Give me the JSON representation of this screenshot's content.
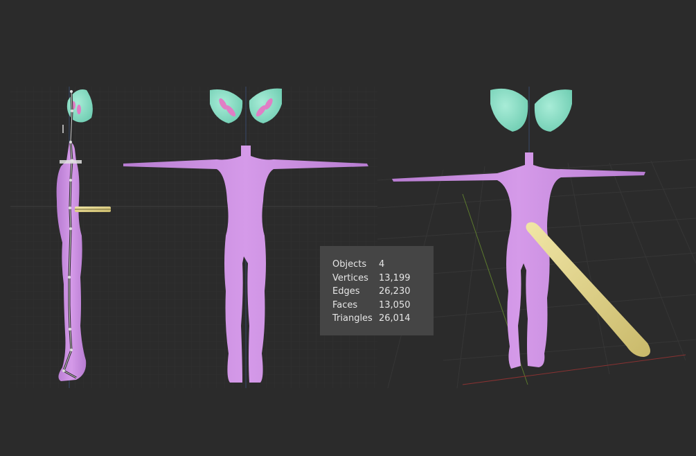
{
  "colors": {
    "background": "#2b2b2b",
    "body": "#cc8fe4",
    "ears": "#8fe0c8",
    "tail": "#e6d88d",
    "bone": "#d9d9d9",
    "stats_bg": "#454545"
  },
  "stats": {
    "rows": [
      {
        "label": "Objects",
        "value": "4"
      },
      {
        "label": "Vertices",
        "value": "13,199"
      },
      {
        "label": "Edges",
        "value": "26,230"
      },
      {
        "label": "Faces",
        "value": "13,050"
      },
      {
        "label": "Triangles",
        "value": "26,014"
      }
    ]
  }
}
